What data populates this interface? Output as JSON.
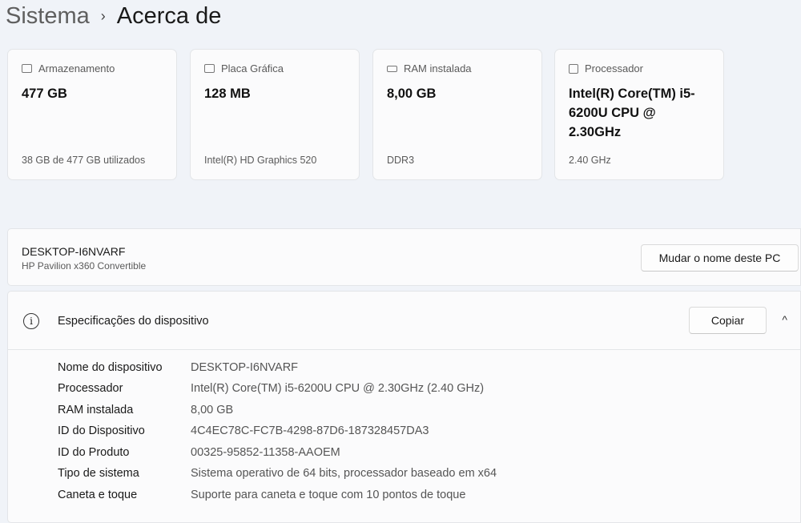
{
  "breadcrumb": {
    "parent": "Sistema",
    "separator": "›",
    "current": "Acerca de"
  },
  "cards": [
    {
      "icon": "storage-icon",
      "label": "Armazenamento",
      "value": "477 GB",
      "sub": "38 GB de 477 GB utilizados"
    },
    {
      "icon": "graphics-card-icon",
      "label": "Placa Gráfica",
      "value": "128 MB",
      "sub": "Intel(R) HD Graphics 520"
    },
    {
      "icon": "ram-icon",
      "label": "RAM instalada",
      "value": "8,00 GB",
      "sub": "DDR3"
    },
    {
      "icon": "processor-icon",
      "label": "Processador",
      "value": "Intel(R) Core(TM) i5-6200U CPU @ 2.30GHz",
      "sub": "2.40 GHz"
    }
  ],
  "device": {
    "name": "DESKTOP-I6NVARF",
    "model": "HP Pavilion x360 Convertible",
    "rename_label": "Mudar o nome deste PC"
  },
  "specs": {
    "title": "Especificações do dispositivo",
    "copy_label": "Copiar",
    "collapse_glyph": "^",
    "rows": [
      {
        "label": "Nome do dispositivo",
        "value": "DESKTOP-I6NVARF"
      },
      {
        "label": "Processador",
        "value": "Intel(R) Core(TM) i5-6200U CPU @ 2.30GHz (2.40 GHz)"
      },
      {
        "label": "RAM instalada",
        "value": "8,00 GB"
      },
      {
        "label": "ID do Dispositivo",
        "value": "4C4EC78C-FC7B-4298-87D6-187328457DA3"
      },
      {
        "label": "ID do Produto",
        "value": "00325-95852-11358-AAOEM"
      },
      {
        "label": "Tipo de sistema",
        "value": "Sistema operativo de 64 bits, processador baseado em x64"
      },
      {
        "label": "Caneta e toque",
        "value": "Suporte para caneta e toque com 10 pontos de toque"
      }
    ]
  }
}
